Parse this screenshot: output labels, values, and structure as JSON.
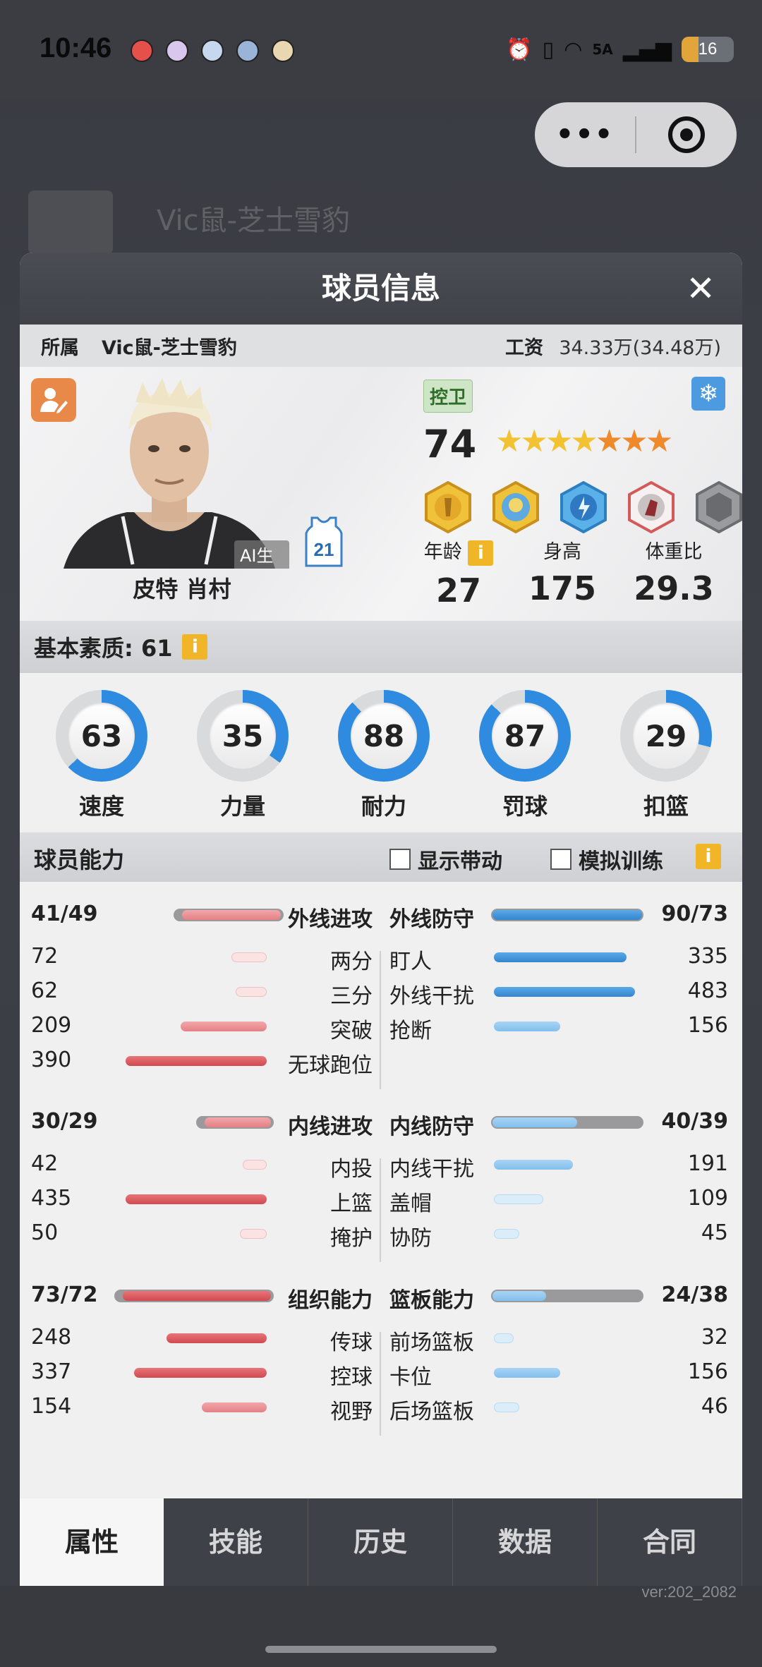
{
  "status_bar": {
    "time": "10:46",
    "network": "5A",
    "battery": "16"
  },
  "capsule": {
    "more": "•••"
  },
  "background": {
    "title": "Vic鼠-芝士雪豹"
  },
  "dialog": {
    "title": "球员信息",
    "close": "✕",
    "team_label": "所属",
    "team": "Vic鼠-芝士雪豹",
    "wage_label": "工资",
    "wage": "34.33万(34.48万)"
  },
  "player": {
    "name": "皮特 肖村",
    "ai_tag": "AI生成",
    "jersey": "21",
    "position": "控卫",
    "overall": "74",
    "stars_gold": 4,
    "stars_orange": 3,
    "age_label": "年龄",
    "age": "27",
    "height_label": "身高",
    "height": "175",
    "weight_label": "体重比",
    "weight": "29.3",
    "info_icon": "i"
  },
  "basic": {
    "title": "基本素质: 61",
    "stats": [
      {
        "label": "速度",
        "value": "63",
        "pct": 0.63
      },
      {
        "label": "力量",
        "value": "35",
        "pct": 0.35
      },
      {
        "label": "耐力",
        "value": "88",
        "pct": 0.88
      },
      {
        "label": "罚球",
        "value": "87",
        "pct": 0.87
      },
      {
        "label": "扣篮",
        "value": "29",
        "pct": 0.29
      }
    ]
  },
  "abilities": {
    "title": "球员能力",
    "show_drive": "显示带动",
    "sim_train": "模拟训练",
    "groups": [
      {
        "left_main": {
          "label": "外线进攻",
          "value": "41/49"
        },
        "right_main": {
          "label": "外线防守",
          "value": "90/73"
        },
        "left": [
          {
            "label": "两分",
            "value": "72"
          },
          {
            "label": "三分",
            "value": "62"
          },
          {
            "label": "突破",
            "value": "209"
          },
          {
            "label": "无球跑位",
            "value": "390"
          }
        ],
        "right": [
          {
            "label": "盯人",
            "value": "335"
          },
          {
            "label": "外线干扰",
            "value": "483"
          },
          {
            "label": "抢断",
            "value": "156"
          }
        ]
      },
      {
        "left_main": {
          "label": "内线进攻",
          "value": "30/29"
        },
        "right_main": {
          "label": "内线防守",
          "value": "40/39"
        },
        "left": [
          {
            "label": "内投",
            "value": "42"
          },
          {
            "label": "上篮",
            "value": "435"
          },
          {
            "label": "掩护",
            "value": "50"
          }
        ],
        "right": [
          {
            "label": "内线干扰",
            "value": "191"
          },
          {
            "label": "盖帽",
            "value": "109"
          },
          {
            "label": "协防",
            "value": "45"
          }
        ]
      },
      {
        "left_main": {
          "label": "组织能力",
          "value": "73/72"
        },
        "right_main": {
          "label": "篮板能力",
          "value": "24/38"
        },
        "left": [
          {
            "label": "传球",
            "value": "248"
          },
          {
            "label": "控球",
            "value": "337"
          },
          {
            "label": "视野",
            "value": "154"
          }
        ],
        "right": [
          {
            "label": "前场篮板",
            "value": "32"
          },
          {
            "label": "卡位",
            "value": "156"
          },
          {
            "label": "后场篮板",
            "value": "46"
          }
        ]
      }
    ]
  },
  "tabs": [
    "属性",
    "技能",
    "历史",
    "数据",
    "合同"
  ],
  "version": "ver:202_2082",
  "colors": {
    "accent_red": "#cf4a50",
    "accent_blue": "#3585cf",
    "ring_blue": "#2f8be0",
    "gold": "#f2c231"
  }
}
